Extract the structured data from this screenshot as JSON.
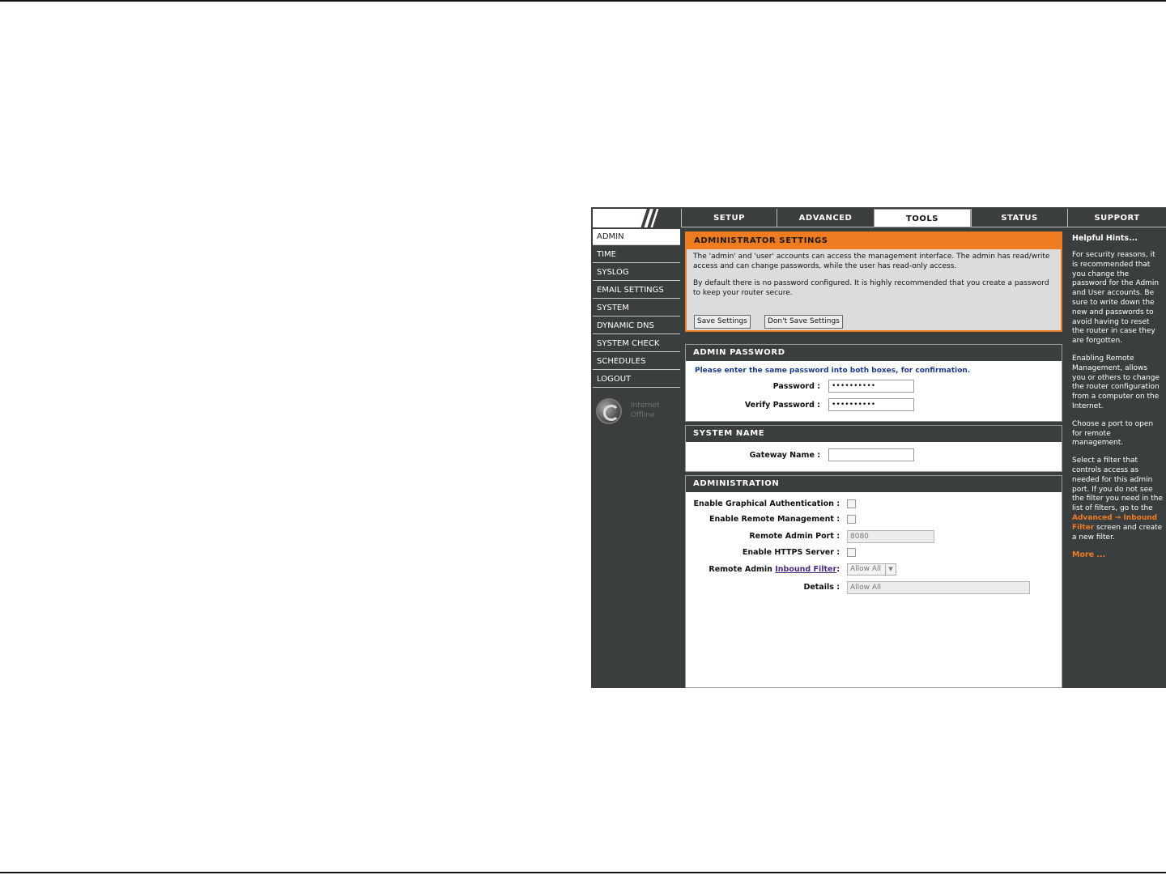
{
  "nav": {
    "tabs": [
      "SETUP",
      "ADVANCED",
      "TOOLS",
      "STATUS"
    ],
    "support_label": "SUPPORT",
    "active_tab": "TOOLS"
  },
  "sidebar": {
    "items": [
      "ADMIN",
      "TIME",
      "SYSLOG",
      "EMAIL SETTINGS",
      "SYSTEM",
      "DYNAMIC DNS",
      "SYSTEM CHECK",
      "SCHEDULES",
      "LOGOUT"
    ],
    "active_item": "ADMIN",
    "status_line1": "Internet",
    "status_line2": "Offline"
  },
  "admin_settings": {
    "title": "ADMINISTRATOR SETTINGS",
    "paragraph1": "The 'admin' and 'user' accounts can access the management interface. The admin has read/write access and can change passwords, while the user has read-only access.",
    "paragraph2": "By default there is no password configured. It is highly recommended that you create a password to keep your router secure.",
    "save_button": "Save Settings",
    "dont_save_button": "Don't Save Settings"
  },
  "admin_password": {
    "title": "ADMIN PASSWORD",
    "instruction": "Please enter the same password into both boxes, for confirmation.",
    "password_label": "Password :",
    "password_value": "••••••••••",
    "verify_label": "Verify Password :",
    "verify_value": "••••••••••"
  },
  "system_name": {
    "title": "SYSTEM NAME",
    "gateway_label": "Gateway Name :",
    "gateway_value": ""
  },
  "administration": {
    "title": "ADMINISTRATION",
    "graphical_auth_label": "Enable Graphical Authentication :",
    "remote_mgmt_label": "Enable Remote Management :",
    "remote_port_label": "Remote Admin Port :",
    "remote_port_value": "8080",
    "https_label": "Enable HTTPS Server :",
    "filter_label_prefix": "Remote Admin",
    "filter_link": "Inbound Filter",
    "filter_label_suffix": ":",
    "filter_value": "Allow All",
    "details_label": "Details :",
    "details_value": "Allow All"
  },
  "support": {
    "title": "Helpful Hints...",
    "hint1": "For security reasons, it is recommended that you change the password for the Admin and User accounts. Be sure to write down the new and passwords to avoid having to reset the router in case they are forgotten.",
    "hint2": "Enabling Remote Management, allows you or others to change the router configuration from a computer on the Internet.",
    "hint3": "Choose a port to open for remote management.",
    "hint4_before": "Select a filter that controls access as needed for this admin port. If you do not see the filter you need in the list of filters, go to the",
    "hint4_link": "Advanced → Inbound Filter",
    "hint4_after": "screen and create a new filter.",
    "more": "More ..."
  },
  "colors": {
    "chrome": "#3b3e3e",
    "accent_orange": "#f07c22",
    "instruction_blue": "#1c3a8c"
  }
}
